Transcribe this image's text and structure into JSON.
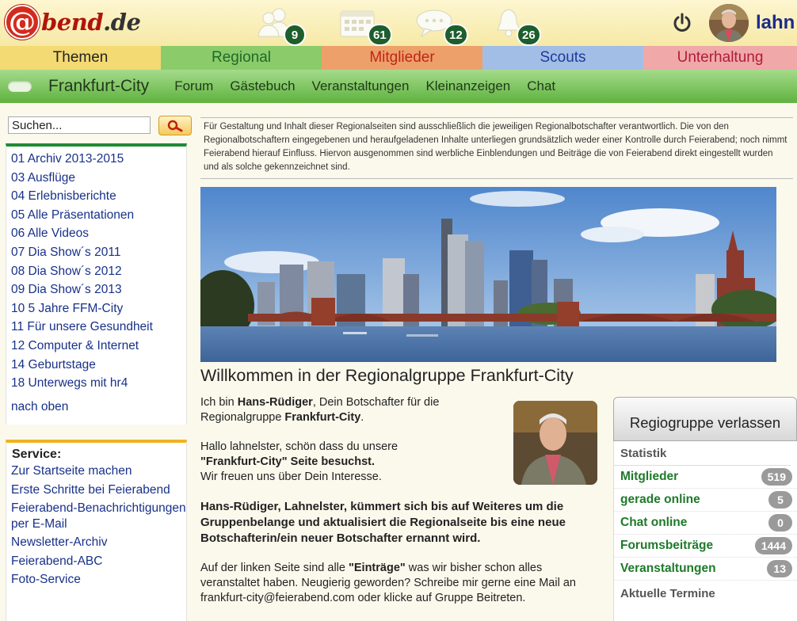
{
  "header": {
    "logo_prefix": "@",
    "logo_word": "bend",
    "logo_tld": ".de",
    "username": "lahn",
    "notifications": [
      {
        "name": "friends",
        "icon": "people-icon",
        "count": "9"
      },
      {
        "name": "calendar",
        "icon": "calendar-icon",
        "count": "61"
      },
      {
        "name": "messages",
        "icon": "speech-bubble-icon",
        "count": "12"
      },
      {
        "name": "alerts",
        "icon": "bell-icon",
        "count": "26"
      }
    ]
  },
  "tabs": [
    {
      "label": "Themen",
      "bg": "#f3da72",
      "color": "#222222"
    },
    {
      "label": "Regional",
      "bg": "#8ccb6a",
      "color": "#1e6a2a"
    },
    {
      "label": "Mitglieder",
      "bg": "#eea06a",
      "color": "#c0241c"
    },
    {
      "label": "Scouts",
      "bg": "#a3bee6",
      "color": "#1e3a9a"
    },
    {
      "label": "Unterhaltung",
      "bg": "#f0a8a8",
      "color": "#b01c3a"
    }
  ],
  "subnav": {
    "title": "Frankfurt-City",
    "links": [
      "Forum",
      "Gästebuch",
      "Veranstaltungen",
      "Kleinanzeigen",
      "Chat"
    ]
  },
  "search": {
    "placeholder": "Suchen..."
  },
  "archive": {
    "items": [
      "01 Archiv 2013-2015",
      "03 Ausflüge",
      "04 Erlebnisberichte",
      "05 Alle Präsentationen",
      "06 Alle Videos",
      "07 Dia Show´s 2011",
      "08 Dia Show´s 2012",
      "09 Dia Show´s 2013",
      "10 5 Jahre FFM-City",
      "11 Für unsere Gesundheit",
      "12 Computer & Internet",
      "14 Geburtstage",
      "18 Unterwegs mit hr4"
    ],
    "back_to_top": "nach oben"
  },
  "service": {
    "title": "Service:",
    "links": [
      "Zur Startseite machen",
      "Erste Schritte bei Feierabend",
      "Feierabend-Benachrichtigungen per E-Mail",
      "Newsletter-Archiv",
      "Feierabend-ABC",
      "Foto-Service"
    ]
  },
  "disclaimer": "Für Gestaltung und Inhalt dieser Regionalseiten sind ausschließlich die jeweiligen Regionalbotschafter verantwortlich. Die von den Regionalbotschaftern eingegebenen und heraufgeladenen Inhalte unterliegen grundsätzlich weder einer Kontrolle durch Feierabend; noch nimmt Feierabend hierauf Einfluss. Hiervon ausgenommen sind werbliche Einblendungen und Beiträge die von Feierabend direkt eingestellt wurden und als solche gekennzeichnet sind.",
  "welcome_title": "Willkommen in der Regionalgruppe Frankfurt-City",
  "content": {
    "intro_1": "Ich bin ",
    "intro_name": "Hans-Rüdiger",
    "intro_2": ", Dein Botschafter für die Regionalgruppe ",
    "intro_group": "Frankfurt-City",
    "intro_3": ".",
    "hallo_1": "Hallo lahnelster, schön dass du unsere",
    "hallo_bold": "\"Frankfurt-City\" Seite besuchst.",
    "hallo_2": "Wir freuen uns über Dein Interesse.",
    "bold_para": "Hans-Rüdiger, Lahnelster, kümmert sich bis auf Weiteres um die Gruppenbelange und aktualisiert die Regionalseite bis eine neue Botschafterin/ein neuer Botschafter ernannt wird.",
    "last_1": "Auf der linken Seite sind alle ",
    "last_bold": "\"Einträge\"",
    "last_2": " was wir bisher schon alles veranstaltet haben. Neugierig geworden? Schreibe mir gerne eine Mail an frankfurt-city@feierabend.com oder klicke auf Gruppe Beitreten."
  },
  "sidebar_right": {
    "leave_button": "Regiogruppe verlassen",
    "stats_title": "Statistik",
    "stats": [
      {
        "label": "Mitglieder",
        "value": "519"
      },
      {
        "label": "gerade online",
        "value": "5"
      },
      {
        "label": "Chat online",
        "value": "0"
      },
      {
        "label": "Forumsbeiträge",
        "value": "1444"
      },
      {
        "label": "Veranstaltungen",
        "value": "13"
      }
    ],
    "termine_title": "Aktuelle Termine"
  }
}
